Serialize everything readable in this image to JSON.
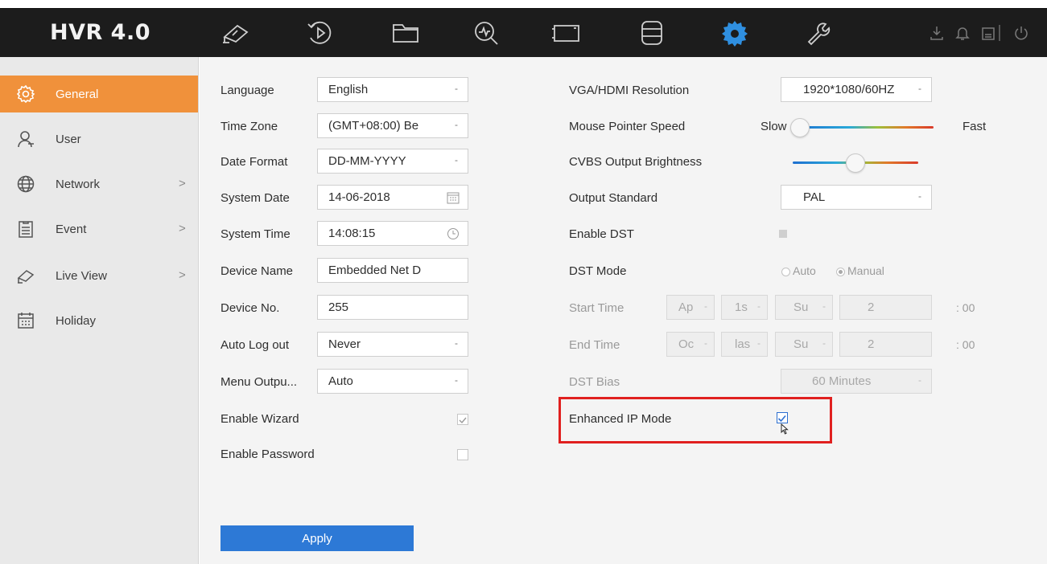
{
  "header": {
    "logo": "HVR 4.0",
    "nav": [
      "live-view-icon",
      "playback-icon",
      "file-management-icon",
      "search-icon",
      "smart-analysis-icon",
      "storage-icon",
      "configuration-icon",
      "maintenance-icon"
    ],
    "active_nav": "configuration-icon",
    "accent": "#2f8fe0",
    "system_icons": [
      "download-icon",
      "alarm-bell-icon",
      "lock-icon",
      "power-icon"
    ]
  },
  "sidebar": {
    "items": [
      {
        "label": "General",
        "icon": "gear-icon",
        "active": true,
        "arrow": ""
      },
      {
        "label": "User",
        "icon": "user-icon",
        "active": false,
        "arrow": ""
      },
      {
        "label": "Network",
        "icon": "globe-icon",
        "active": false,
        "arrow": ">"
      },
      {
        "label": "Event",
        "icon": "clipboard-icon",
        "active": false,
        "arrow": ">"
      },
      {
        "label": "Live View",
        "icon": "camera-icon",
        "active": false,
        "arrow": ">"
      },
      {
        "label": "Holiday",
        "icon": "calendar-icon",
        "active": false,
        "arrow": ""
      }
    ],
    "active_color": "#f0913b"
  },
  "left_form": {
    "language": {
      "label": "Language",
      "value": "English"
    },
    "time_zone": {
      "label": "Time Zone",
      "value": "(GMT+08:00) Be"
    },
    "date_format": {
      "label": "Date Format",
      "value": "DD-MM-YYYY"
    },
    "system_date": {
      "label": "System Date",
      "value": "14-06-2018"
    },
    "system_time": {
      "label": "System Time",
      "value": "14:08:15"
    },
    "device_name": {
      "label": "Device Name",
      "value": "Embedded Net D"
    },
    "device_no": {
      "label": "Device No.",
      "value": "255"
    },
    "auto_logout": {
      "label": "Auto Log out",
      "value": "Never"
    },
    "menu_output": {
      "label": "Menu Outpu...",
      "value": "Auto"
    },
    "enable_wizard": {
      "label": "Enable Wizard",
      "checked": true
    },
    "enable_password": {
      "label": "Enable Password",
      "checked": false
    }
  },
  "right_form": {
    "resolution": {
      "label": "VGA/HDMI Resolution",
      "value": "1920*1080/60HZ"
    },
    "mouse_speed": {
      "label": "Mouse Pointer Speed",
      "min_label": "Slow",
      "max_label": "Fast",
      "level": 0.0
    },
    "cvbs_brightness": {
      "label": "CVBS Output Brightness",
      "level": 0.5
    },
    "output_standard": {
      "label": "Output Standard",
      "value": "PAL"
    },
    "enable_dst": {
      "label": "Enable DST",
      "checked": false
    },
    "dst_mode": {
      "label": "DST Mode",
      "options": [
        "Auto",
        "Manual"
      ],
      "selected": "Manual"
    },
    "start_time": {
      "label": "Start Time",
      "month": "Ap",
      "week": "1s",
      "day": "Su",
      "hour": "2",
      "suffix": ": 00"
    },
    "end_time": {
      "label": "End Time",
      "month": "Oc",
      "week": "las",
      "day": "Su",
      "hour": "2",
      "suffix": ": 00"
    },
    "dst_bias": {
      "label": "DST Bias",
      "value": "60 Minutes"
    },
    "enhanced_ip": {
      "label": "Enhanced IP Mode",
      "checked": true
    }
  },
  "actions": {
    "apply_label": "Apply"
  },
  "annotation": {
    "highlight_color": "#e0201f"
  }
}
